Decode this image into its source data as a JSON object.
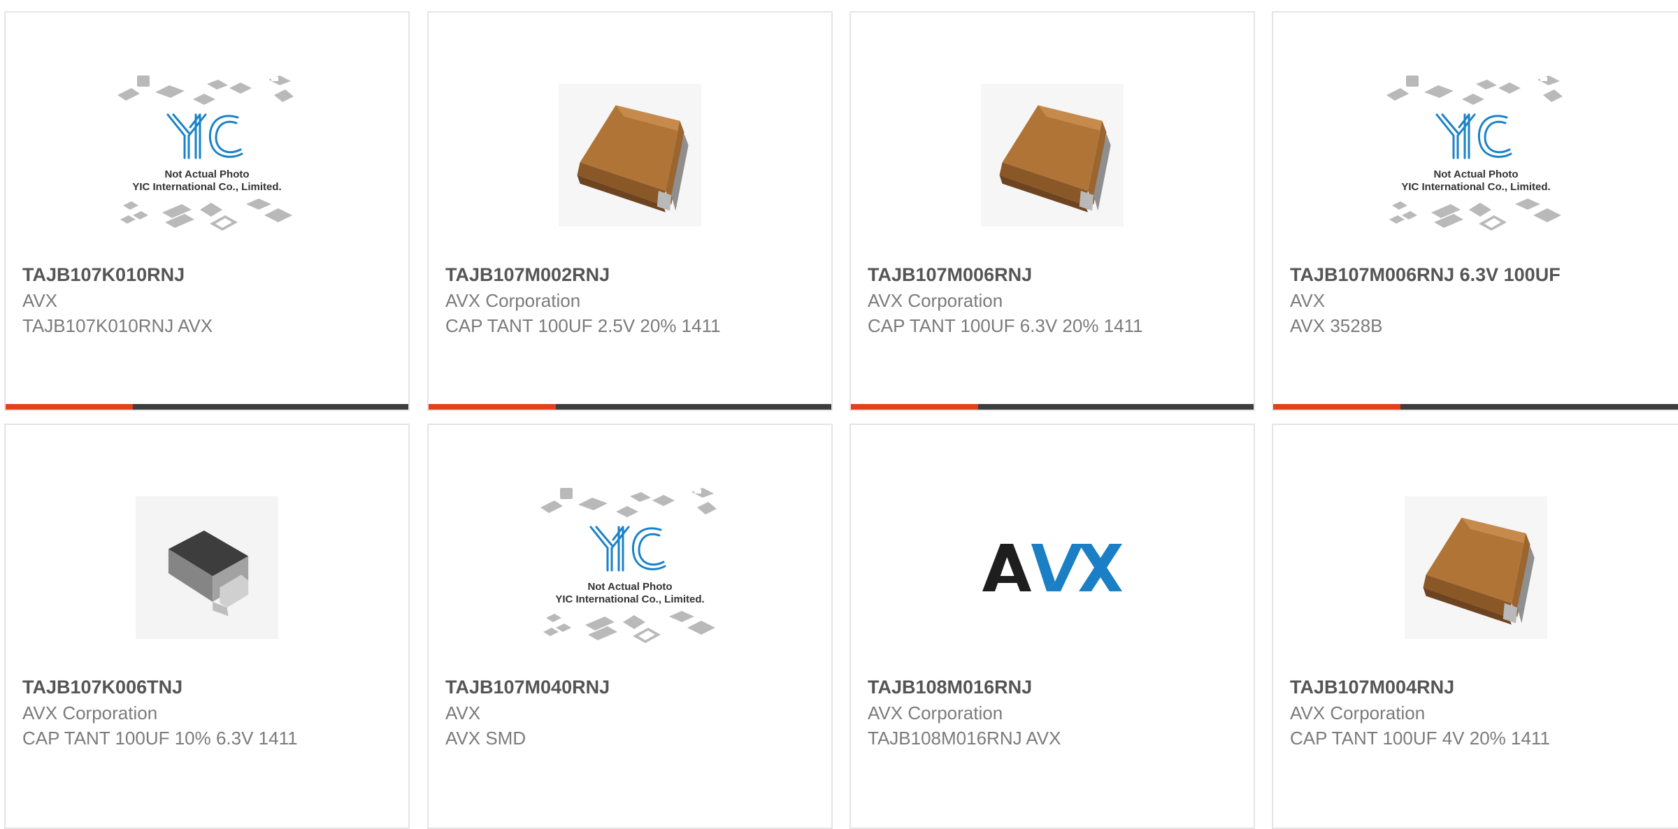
{
  "colors": {
    "accent": "#e2411b",
    "bar": "#3d3d3d",
    "yic_blue": "#1a82c8",
    "avx_blue": "#1a7fc4"
  },
  "products": [
    {
      "part_number": "TAJB107K010RNJ",
      "manufacturer": "AVX",
      "description": "TAJB107K010RNJ AVX",
      "image": "yic-placeholder-image",
      "yic": {
        "logo_text": "YIC",
        "line1": "Not Actual Photo",
        "line2": "YIC International Co., Limited."
      }
    },
    {
      "part_number": "TAJB107M002RNJ",
      "manufacturer": "AVX Corporation",
      "description": "CAP TANT 100UF 2.5V 20% 1411",
      "image": "tantalum-capacitor-image"
    },
    {
      "part_number": "TAJB107M006RNJ",
      "manufacturer": "AVX Corporation",
      "description": "CAP TANT 100UF 6.3V 20% 1411",
      "image": "tantalum-capacitor-image"
    },
    {
      "part_number": "TAJB107M006RNJ 6.3V 100UF",
      "manufacturer": "AVX",
      "description": "AVX 3528B",
      "image": "yic-placeholder-image",
      "yic": {
        "logo_text": "YIC",
        "line1": "Not Actual Photo",
        "line2": "YIC International Co., Limited."
      }
    },
    {
      "part_number": "TAJB107K006TNJ",
      "manufacturer": "AVX Corporation",
      "description": "CAP TANT 100UF 10% 6.3V 1411",
      "image": "smd-component-image"
    },
    {
      "part_number": "TAJB107M040RNJ",
      "manufacturer": "AVX",
      "description": "AVX SMD",
      "image": "yic-placeholder-image",
      "yic": {
        "logo_text": "YIC",
        "line1": "Not Actual Photo",
        "line2": "YIC International Co., Limited."
      }
    },
    {
      "part_number": "TAJB108M016RNJ",
      "manufacturer": "AVX Corporation",
      "description": "TAJB108M016RNJ AVX",
      "image": "avx-logo-image",
      "avx_logo_text": "AVX"
    },
    {
      "part_number": "TAJB107M004RNJ",
      "manufacturer": "AVX Corporation",
      "description": "CAP TANT 100UF 4V 20% 1411",
      "image": "tantalum-capacitor-image"
    }
  ]
}
